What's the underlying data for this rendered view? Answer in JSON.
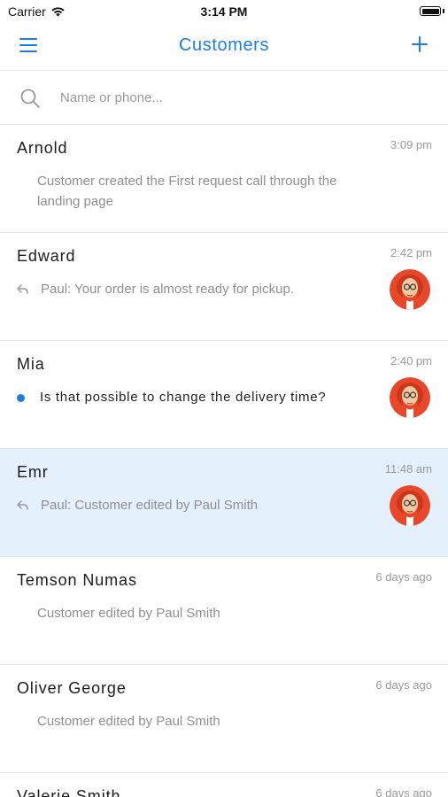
{
  "status_bar": {
    "carrier": "Carrier",
    "time": "3:14 PM",
    "battery_level": 1.0
  },
  "nav": {
    "title": "Customers",
    "menu_icon": "hamburger-menu-icon",
    "add_icon": "plus-icon",
    "accent_color": "#1a7ee0"
  },
  "search": {
    "placeholder": "Name or phone...",
    "value": "",
    "icon": "search-icon"
  },
  "customers": [
    {
      "name": "Arnold",
      "time": "3:09 pm",
      "message": "Customer created the First request call through the landing page",
      "reply": false,
      "unread": false,
      "avatar": false,
      "selected": false
    },
    {
      "name": "Edward",
      "time": "2:42 pm",
      "message": "Paul: Your order is almost ready for pickup.",
      "reply": true,
      "unread": false,
      "avatar": true,
      "selected": false
    },
    {
      "name": "Mia",
      "time": "2:40 pm",
      "message": "Is that possible to change the delivery time?",
      "reply": false,
      "unread": true,
      "avatar": true,
      "selected": false
    },
    {
      "name": "Emr",
      "time": "11:48 am",
      "message": "Paul: Customer edited by Paul Smith",
      "reply": true,
      "unread": false,
      "avatar": true,
      "selected": true
    },
    {
      "name": "Temson Numas",
      "time": "6 days ago",
      "message": "Customer edited by Paul Smith",
      "reply": false,
      "unread": false,
      "avatar": false,
      "selected": false
    },
    {
      "name": "Oliver George",
      "time": "6 days ago",
      "message": "Customer edited by Paul Smith",
      "reply": false,
      "unread": false,
      "avatar": false,
      "selected": false
    },
    {
      "name": "Valerie Smith",
      "time": "6 days ago",
      "message": "",
      "reply": false,
      "unread": false,
      "avatar": false,
      "selected": false
    }
  ],
  "colors": {
    "selected_row": "#e4f0fc",
    "unread_dot": "#1a7ee0",
    "avatar_background": "#e8472a",
    "avatar_skin": "#f3c9a2"
  }
}
